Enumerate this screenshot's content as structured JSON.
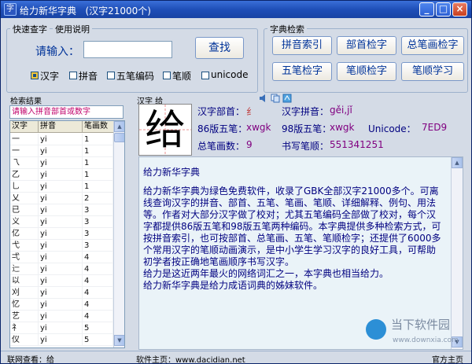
{
  "window": {
    "title": "给力新华字典   (汉字21000个)",
    "buttons": {
      "minimize": "_",
      "maximize": "□",
      "close": "×"
    }
  },
  "quick_lookup": {
    "title": "快速查字",
    "usage_link": "使用说明",
    "prompt": "请输入：",
    "input_value": "",
    "search_button": "查找",
    "options": [
      {
        "label": "汉字",
        "checked": true
      },
      {
        "label": "拼音",
        "checked": false
      },
      {
        "label": "五笔编码",
        "checked": false
      },
      {
        "label": "笔顺",
        "checked": false
      },
      {
        "label": "unicode",
        "checked": false
      }
    ]
  },
  "dictionary_search": {
    "title": "字典检索",
    "buttons": [
      "拼音索引",
      "部首检字",
      "总笔画检字",
      "五笔检字",
      "笔顺检字",
      "笔顺学习"
    ]
  },
  "results": {
    "title": "检索结果",
    "hint": "请输入拼音部首或数字",
    "columns": [
      "汉字",
      "拼音",
      "笔画数"
    ],
    "rows": [
      [
        "一",
        "yi",
        "1"
      ],
      [
        "一",
        "yi",
        "1"
      ],
      [
        "乁",
        "yi",
        "1"
      ],
      [
        "乙",
        "yi",
        "1"
      ],
      [
        "乚",
        "yi",
        "1"
      ],
      [
        "乂",
        "yi",
        "2"
      ],
      [
        "已",
        "yi",
        "3"
      ],
      [
        "义",
        "yi",
        "3"
      ],
      [
        "亿",
        "yi",
        "3"
      ],
      [
        "弋",
        "yi",
        "3"
      ],
      [
        "弌",
        "yi",
        "4"
      ],
      [
        "辷",
        "yi",
        "4"
      ],
      [
        "以",
        "yi",
        "4"
      ],
      [
        "刈",
        "yi",
        "4"
      ],
      [
        "忆",
        "yi",
        "4"
      ],
      [
        "艺",
        "yi",
        "4"
      ],
      [
        "礻",
        "yi",
        "5"
      ],
      [
        "仪",
        "yi",
        "5"
      ]
    ]
  },
  "char_info": {
    "title": "汉字 给",
    "character": "给",
    "radical_label": "汉字部首：",
    "radical_value": "纟",
    "pinyin_label": "汉字拼音：",
    "pinyin_value": "gěi,jǐ",
    "wubi86_label": "86版五笔：",
    "wubi86_value": "xwgk",
    "wubi98_label": "98版五笔：",
    "wubi98_value": "xwgk",
    "unicode_label": "Unicode：",
    "unicode_value": "7ED9",
    "strokes_label": "总笔画数：",
    "strokes_value": "9",
    "order_label": "书写笔顺：",
    "order_value": "551341251"
  },
  "description": {
    "heading": "给力新华字典",
    "paragraphs": [
      "给力新华字典为绿色免费软件，收录了GBK全部汉字21000多个。可离线查询汉字的拼音、部首、五笔、笔画、笔顺、详细解释、例句、用法等。作者对大部分汉字做了校对；尤其五笔编码全部做了校对，每个汉字都提供86版五笔和98版五笔两种编码。本字典提供多种检索方式，可按拼音索引，也可按部首、总笔画、五笔、笔顺检字；还提供了6000多个常用汉字的笔顺动画演示，是中小学生学习汉字的良好工具，可帮助初学者按正确地笔画顺序书写汉字。",
      "给力是这近两年最火的网络词汇之一，本字典也相当给力。",
      "给力新华字典是给力成语词典的姊妹软件。"
    ]
  },
  "status_bar": {
    "left": "联网查看：给",
    "center": "软件主页：www.dacidian.net",
    "right": "官方主页"
  },
  "watermark": {
    "brand": "当下软件园",
    "url": "www.downxia.com"
  }
}
